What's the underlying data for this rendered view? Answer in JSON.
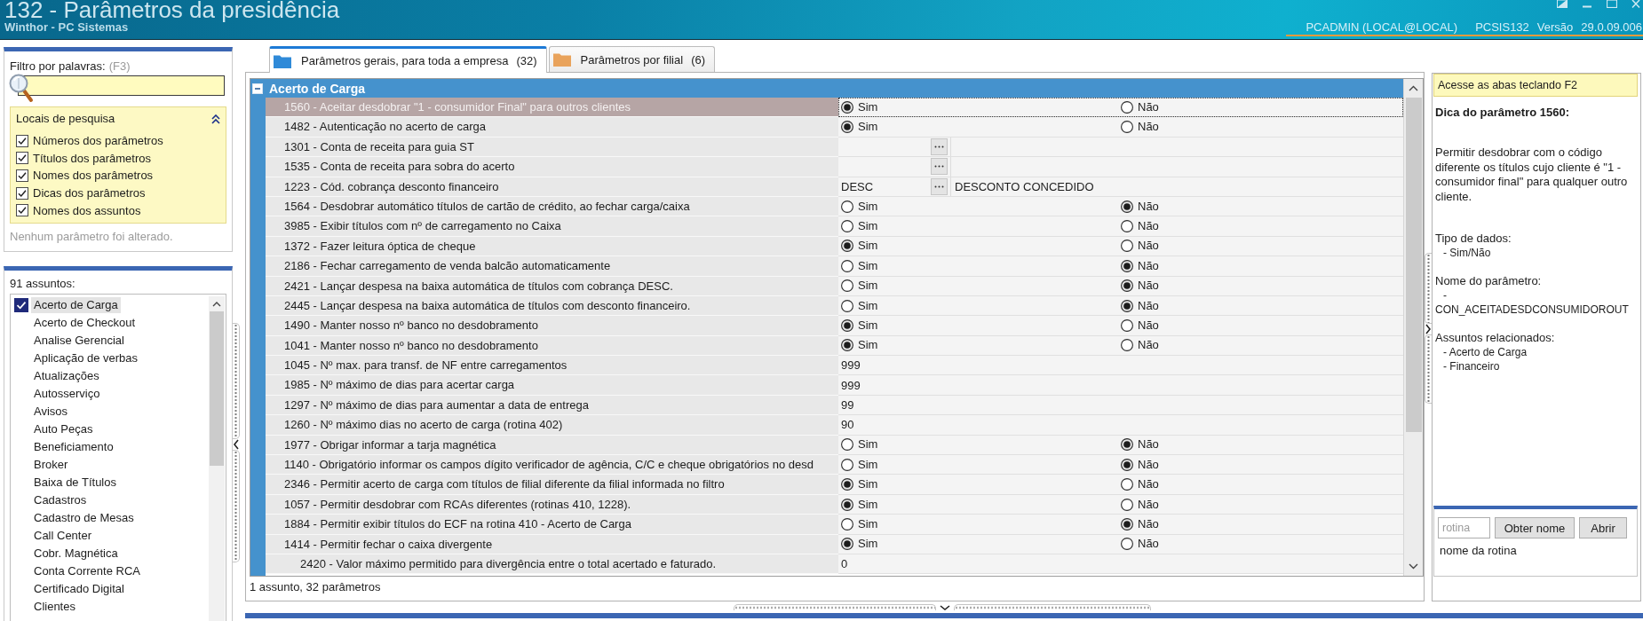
{
  "window": {
    "title": "132 - Parâmetros da presidência",
    "subtitle": "Winthor - PC Sistemas",
    "user": "PCADMIN (LOCAL@LOCAL)",
    "program": "PCSIS132",
    "version_label": "Versão",
    "version": "29.0.09.006"
  },
  "filter": {
    "label": "Filtro por palavras:",
    "shortcut": "(F3)",
    "search_places": {
      "title": "Locais de pesquisa",
      "expanded": true,
      "options": [
        {
          "label": "Números dos parâmetros",
          "checked": true
        },
        {
          "label": "Títulos dos parâmetros",
          "checked": true
        },
        {
          "label": "Nomes dos parâmetros",
          "checked": true
        },
        {
          "label": "Dicas dos parâmetros",
          "checked": true
        },
        {
          "label": "Nomes dos assuntos",
          "checked": true
        }
      ]
    },
    "status": "Nenhum parâmetro foi alterado."
  },
  "subjects": {
    "count_label": "91 assuntos:",
    "items": [
      {
        "label": "Acerto de Carga",
        "checked": true,
        "selected": true
      },
      {
        "label": "Acerto de Checkout",
        "checked": false,
        "selected": false
      },
      {
        "label": "Analise Gerencial",
        "checked": false,
        "selected": false
      },
      {
        "label": "Aplicação de verbas",
        "checked": false,
        "selected": false
      },
      {
        "label": "Atualizações",
        "checked": false,
        "selected": false
      },
      {
        "label": "Autosserviço",
        "checked": false,
        "selected": false
      },
      {
        "label": "Avisos",
        "checked": false,
        "selected": false
      },
      {
        "label": "Auto Peças",
        "checked": false,
        "selected": false
      },
      {
        "label": "Beneficiamento",
        "checked": false,
        "selected": false
      },
      {
        "label": "Broker",
        "checked": false,
        "selected": false
      },
      {
        "label": "Baixa de Títulos",
        "checked": false,
        "selected": false
      },
      {
        "label": "Cadastros",
        "checked": false,
        "selected": false
      },
      {
        "label": "Cadastro de Mesas",
        "checked": false,
        "selected": false
      },
      {
        "label": "Call Center",
        "checked": false,
        "selected": false
      },
      {
        "label": "Cobr. Magnética",
        "checked": false,
        "selected": false
      },
      {
        "label": "Conta Corrente RCA",
        "checked": false,
        "selected": false
      },
      {
        "label": "Certificado Digital",
        "checked": false,
        "selected": false
      },
      {
        "label": "Clientes",
        "checked": false,
        "selected": false
      }
    ]
  },
  "tabs": [
    {
      "label": "Parâmetros gerais, para toda a empresa",
      "count": "(32)",
      "selected": true,
      "color": "#2f8ad8"
    },
    {
      "label": "Parâmetros por filial",
      "count": "(6)",
      "selected": false,
      "color": "#e9a35c"
    }
  ],
  "group": {
    "title": "Acerto de Carga",
    "expanded": true,
    "parameters": [
      {
        "label": "1560 - Aceitar desdobrar \"1 - consumidor Final\" para outros clientes",
        "kind": "yes_no",
        "selected": true,
        "options": [
          {
            "label": "Sim",
            "selected": true
          },
          {
            "label": "Não",
            "selected": false
          }
        ]
      },
      {
        "label": "1482 - Autenticação no acerto de carga",
        "kind": "yes_no",
        "selected": false,
        "options": [
          {
            "label": "Sim",
            "selected": true
          },
          {
            "label": "Não",
            "selected": false
          }
        ]
      },
      {
        "label": "1301 - Conta de receita para guia ST",
        "kind": "lookup",
        "selected": false
      },
      {
        "label": "1535 - Conta de receita para sobra do acerto",
        "kind": "lookup",
        "selected": false
      },
      {
        "label": "1223 - Cód. cobrança desconto financeiro",
        "kind": "lookup",
        "selected": false,
        "value": "DESC",
        "description": "DESCONTO CONCEDIDO"
      },
      {
        "label": "1564 - Desdobrar automático títulos de cartão de crédito, ao fechar carga/caixa",
        "kind": "yes_no",
        "selected": false,
        "options": [
          {
            "label": "Sim",
            "selected": false
          },
          {
            "label": "Não",
            "selected": true
          }
        ]
      },
      {
        "label": "3985 - Exibir títulos com nº de carregamento no Caixa",
        "kind": "yes_no",
        "selected": false,
        "options": [
          {
            "label": "Sim",
            "selected": false
          },
          {
            "label": "Não",
            "selected": false
          }
        ]
      },
      {
        "label": "1372 - Fazer leitura óptica de cheque",
        "kind": "yes_no",
        "selected": false,
        "options": [
          {
            "label": "Sim",
            "selected": true
          },
          {
            "label": "Não",
            "selected": false
          }
        ]
      },
      {
        "label": "2186 - Fechar carregamento de venda balcão automaticamente",
        "kind": "yes_no",
        "selected": false,
        "options": [
          {
            "label": "Sim",
            "selected": false
          },
          {
            "label": "Não",
            "selected": true
          }
        ]
      },
      {
        "label": "2421 - Lançar despesa na baixa automática de títulos com cobrança DESC.",
        "kind": "yes_no",
        "selected": false,
        "options": [
          {
            "label": "Sim",
            "selected": false
          },
          {
            "label": "Não",
            "selected": true
          }
        ]
      },
      {
        "label": "2445 - Lançar despesa na baixa automática de títulos com desconto financeiro.",
        "kind": "yes_no",
        "selected": false,
        "options": [
          {
            "label": "Sim",
            "selected": false
          },
          {
            "label": "Não",
            "selected": true
          }
        ]
      },
      {
        "label": "1490 - Manter nosso nº banco no desdobramento",
        "kind": "yes_no",
        "selected": false,
        "options": [
          {
            "label": "Sim",
            "selected": true
          },
          {
            "label": "Não",
            "selected": false
          }
        ]
      },
      {
        "label": "1041 - Manter nosso nº banco no desdobramento",
        "kind": "yes_no",
        "selected": false,
        "options": [
          {
            "label": "Sim",
            "selected": true
          },
          {
            "label": "Não",
            "selected": false
          }
        ]
      },
      {
        "label": "1045 - Nº max. para transf. de NF entre carregamentos",
        "kind": "number",
        "selected": false,
        "value": "999"
      },
      {
        "label": "1985 - Nº máximo de dias para acertar carga",
        "kind": "number",
        "selected": false,
        "value": "999"
      },
      {
        "label": "1297 - Nº máximo de dias para aumentar a data de entrega",
        "kind": "number",
        "selected": false,
        "value": "99"
      },
      {
        "label": "1260 - Nº máximo dias no acerto de carga (rotina 402)",
        "kind": "number",
        "selected": false,
        "value": "90"
      },
      {
        "label": "1977 - Obrigar informar a tarja magnética",
        "kind": "yes_no",
        "selected": false,
        "options": [
          {
            "label": "Sim",
            "selected": false
          },
          {
            "label": "Não",
            "selected": true
          }
        ]
      },
      {
        "label": "1140 - Obrigatório informar os campos dígito verificador de agência, C/C e cheque obrigatórios no desd",
        "kind": "yes_no",
        "selected": false,
        "options": [
          {
            "label": "Sim",
            "selected": false
          },
          {
            "label": "Não",
            "selected": true
          }
        ]
      },
      {
        "label": "2346 - Permitir acerto de carga com títulos de filial diferente da filial informada no filtro",
        "kind": "yes_no",
        "selected": false,
        "options": [
          {
            "label": "Sim",
            "selected": true
          },
          {
            "label": "Não",
            "selected": false
          }
        ]
      },
      {
        "label": "1057 - Permitir desdobrar com RCAs diferentes (rotinas 410, 1228).",
        "kind": "yes_no",
        "selected": false,
        "options": [
          {
            "label": "Sim",
            "selected": true
          },
          {
            "label": "Não",
            "selected": false
          }
        ]
      },
      {
        "label": "1884 - Permitir exibir títulos do ECF na rotina 410 - Acerto de Carga",
        "kind": "yes_no",
        "selected": false,
        "options": [
          {
            "label": "Sim",
            "selected": false
          },
          {
            "label": "Não",
            "selected": true
          }
        ]
      },
      {
        "label": "1414 - Permitir fechar o caixa divergente",
        "kind": "yes_no",
        "selected": false,
        "options": [
          {
            "label": "Sim",
            "selected": true
          },
          {
            "label": "Não",
            "selected": false
          }
        ],
        "children": [
          {
            "label": "2420 - Valor máximo permitido para divergência entre o total acertado e faturado.",
            "kind": "number",
            "selected": false,
            "value": "0"
          }
        ]
      }
    ]
  },
  "status_bar": "1 assunto, 32 parâmetros",
  "tip_panel": {
    "hint": "Acesse as abas teclando F2",
    "title": "Dica do parâmetro 1560:",
    "description": "Permitir desdobrar com o código diferente os títulos cujo cliente é \"1 - consumidor final\" para qualquer outro cliente.",
    "sections": [
      {
        "heading": "Tipo de dados:",
        "lines": [
          "- Sim/Não"
        ]
      },
      {
        "heading": "Nome do parâmetro:",
        "lines": [
          "- CON_ACEITADESDCONSUMIDOROUT"
        ]
      },
      {
        "heading": "Assuntos relacionados:",
        "lines": [
          "- Acerto de Carga",
          "- Financeiro"
        ]
      }
    ]
  },
  "routine": {
    "placeholder": "rotina",
    "buttons": [
      "Obter nome",
      "Abrir"
    ],
    "result": "nome da rotina"
  }
}
